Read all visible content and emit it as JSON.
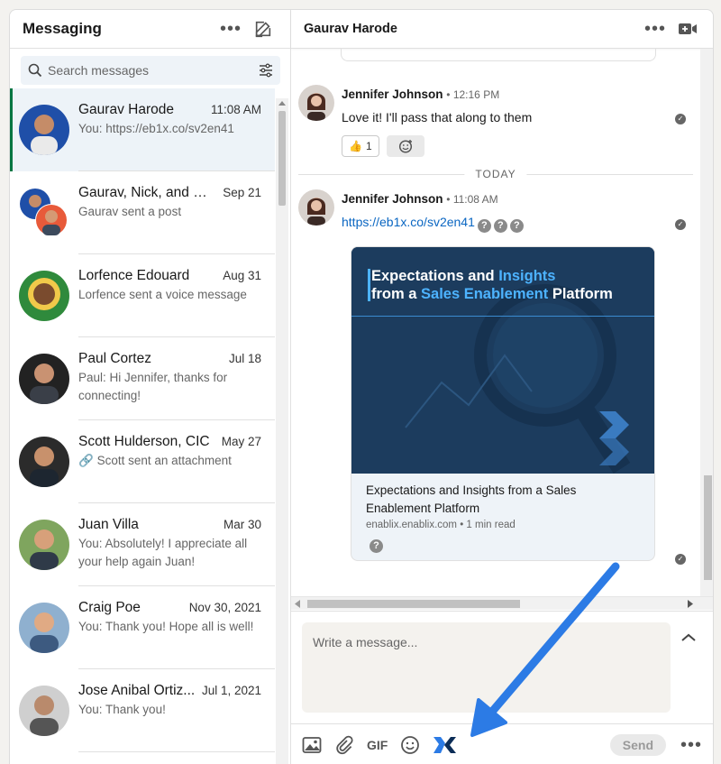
{
  "sidebar": {
    "title": "Messaging",
    "search_placeholder": "Search messages",
    "conversations": [
      {
        "name": "Gaurav Harode",
        "date": "11:08 AM",
        "snippet": "You: https://eb1x.co/sv2en41"
      },
      {
        "name": "Gaurav, Nick, and you",
        "date": "Sep 21",
        "snippet": "Gaurav sent a post"
      },
      {
        "name": "Lorfence Edouard",
        "date": "Aug 31",
        "snippet": "Lorfence sent a voice message"
      },
      {
        "name": "Paul Cortez",
        "date": "Jul 18",
        "snippet": "Paul: Hi Jennifer, thanks for connecting!"
      },
      {
        "name": "Scott Hulderson, CIC",
        "date": "May 27",
        "snippet": "Scott sent an attachment"
      },
      {
        "name": "Juan Villa",
        "date": "Mar 30",
        "snippet": "You: Absolutely! I appreciate all your help again Juan!"
      },
      {
        "name": "Craig Poe",
        "date": "Nov 30, 2021",
        "snippet": "You: Thank you! Hope all is well!"
      },
      {
        "name": "Jose Anibal Ortiz...",
        "date": "Jul 1, 2021",
        "snippet": "You: Thank you!"
      }
    ]
  },
  "thread": {
    "title": "Gaurav Harode",
    "messages": [
      {
        "sender": "Jennifer Johnson",
        "time": "12:16 PM",
        "text": "Love it! I'll pass that along to them",
        "reaction_emoji": "👍",
        "reaction_count": "1"
      },
      {
        "sender": "Jennifer Johnson",
        "time": "11:08 AM",
        "link": "https://eb1x.co/sv2en41"
      }
    ],
    "divider": "TODAY",
    "card": {
      "headline_1a": "Expectations and ",
      "headline_1b": "Insights",
      "headline_2a": "from a ",
      "headline_2b": "Sales Enablement",
      "headline_2c": " Platform",
      "title": "Expectations and Insights from a Sales Enablement Platform",
      "source": "enablix.enablix.com • 1 min read"
    }
  },
  "compose": {
    "placeholder": "Write a message...",
    "gif_label": "GIF",
    "send_label": "Send"
  },
  "colors": {
    "accent": "#0a66c2",
    "active_bar": "#057642",
    "arrow": "#2c7be5"
  }
}
